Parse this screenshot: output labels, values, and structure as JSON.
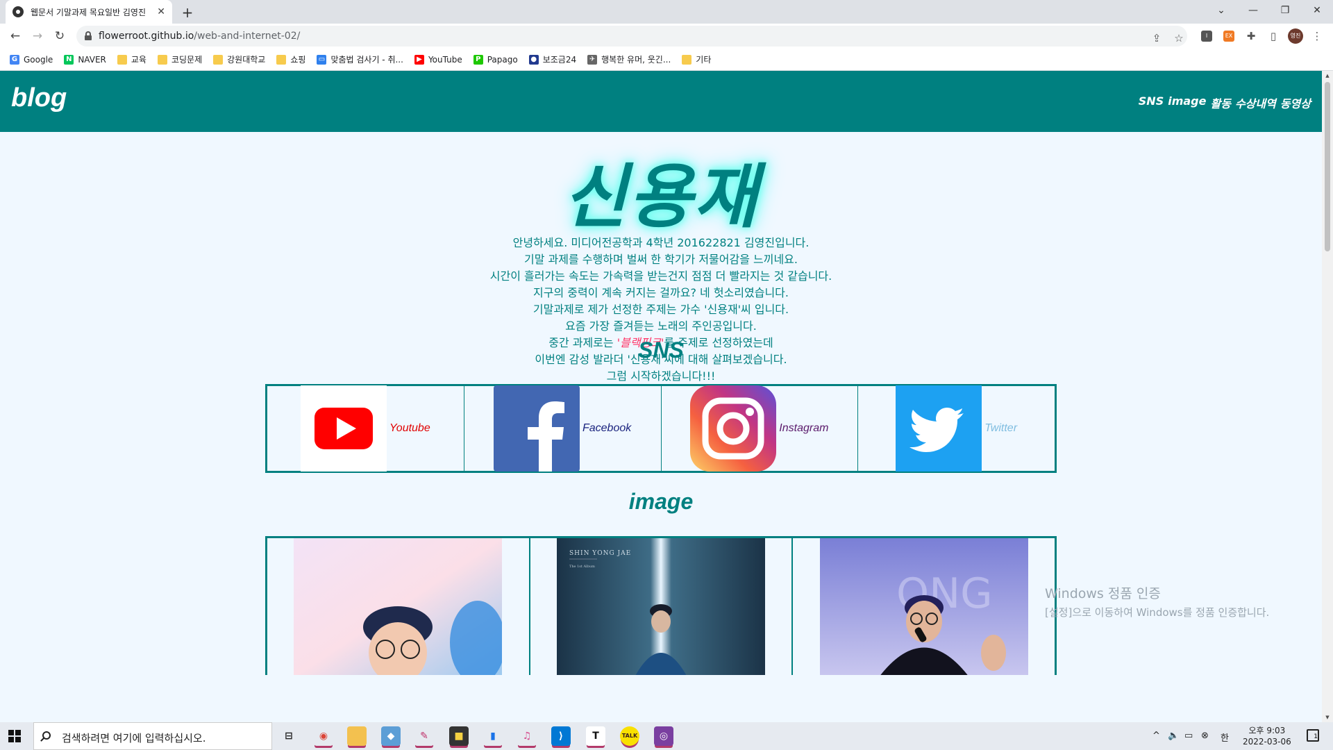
{
  "browser": {
    "tab_title": "웹문서 기말과제 목요일반 김영진",
    "tab_close": "✕",
    "new_tab": "+",
    "url_host": "flowerroot.github.io",
    "url_path": "/web-and-internet-02/",
    "window_controls": {
      "chevron": "⌄",
      "minimize": "—",
      "restore": "❐",
      "close": "✕"
    },
    "nav": {
      "back": "←",
      "forward": "→",
      "reload": "↻"
    },
    "toolbar_icons": {
      "share": "⇪",
      "star": "☆",
      "ext1": "I",
      "ext2": "EX",
      "puzzle": "✚",
      "sidepanel": "▯",
      "menu": "⋮"
    },
    "profile_initials": "영진",
    "bookmarks": [
      {
        "label": "Google",
        "icon": "google-icon",
        "glyph": "G",
        "color": "#4285f4"
      },
      {
        "label": "NAVER",
        "icon": "naver-icon",
        "glyph": "N",
        "color": "#03c75a"
      },
      {
        "label": "교육",
        "icon": "folder-icon",
        "glyph": "",
        "color": "#f7cb4d"
      },
      {
        "label": "코딩문제",
        "icon": "folder-icon",
        "glyph": "",
        "color": "#f7cb4d"
      },
      {
        "label": "강원대학교",
        "icon": "folder-icon",
        "glyph": "",
        "color": "#f7cb4d"
      },
      {
        "label": "쇼핑",
        "icon": "folder-icon",
        "glyph": "",
        "color": "#f7cb4d"
      },
      {
        "label": "맞춤법 검사기 - 취...",
        "icon": "speller-icon",
        "glyph": "▭",
        "color": "#2f80ed"
      },
      {
        "label": "YouTube",
        "icon": "youtube-icon",
        "glyph": "▶",
        "color": "#ff0000"
      },
      {
        "label": "Papago",
        "icon": "papago-icon",
        "glyph": "P",
        "color": "#1ec800"
      },
      {
        "label": "보조금24",
        "icon": "gov-icon",
        "glyph": "●",
        "color": "#223a8f"
      },
      {
        "label": "행복한 유머, 웃긴...",
        "icon": "humor-icon",
        "glyph": "✈",
        "color": "#666666"
      },
      {
        "label": "기타",
        "icon": "folder-icon",
        "glyph": "",
        "color": "#f7cb4d"
      }
    ]
  },
  "site": {
    "brand": "blog",
    "nav": [
      "SNS",
      "image",
      "활동",
      "수상내역",
      "동영상"
    ],
    "hero_name": "신용재",
    "intro": [
      "안녕하세요. 미디어전공학과 4학년 201622821 김영진입니다.",
      "기말 과제를 수행하며 벌써 한 학기가 저물어감을 느끼네요.",
      "시간이 흘러가는 속도는 가속력을 받는건지 점점 더 빨라지는 것 같습니다.",
      "지구의 중력이 계속 커지는 걸까요? 네 헛소리였습니다.",
      "기말과제로 제가 선정한 주제는 가수 '신용재'씨 입니다.",
      "요즘 가장 즐겨듣는 노래의 주인공입니다."
    ],
    "intro_mid": {
      "before": "중간 과제로는 ",
      "highlight": "'블랙핑크'",
      "after": "를 주제로 선정하였는데"
    },
    "intro_end": [
      "이번엔 감성 발라더 '신용재'씨에 대해 살펴보겠습니다.",
      "그럼 시작하겠습니다!!!"
    ],
    "sns_title": "SNS",
    "sns": [
      {
        "label": "Youtube",
        "color": "#e00000"
      },
      {
        "label": "Facebook",
        "color": "#1a237e"
      },
      {
        "label": "Instagram",
        "color": "#5a1a6b"
      },
      {
        "label": "Twitter",
        "color": "#7fbde0"
      }
    ],
    "image_title": "image",
    "album_caption_1": "SHIN YONG JAE",
    "album_caption_2": "The 1st Album"
  },
  "watermark": {
    "title": "Windows 정품 인증",
    "subtitle": "[설정]으로 이동하여 Windows를 정품 인증합니다."
  },
  "taskbar": {
    "search_placeholder": "검색하려면 여기에 입력하십시오.",
    "apps": [
      {
        "name": "task-view-icon",
        "glyph": "⊟",
        "color": "transparent",
        "fg": "#222"
      },
      {
        "name": "chrome-icon",
        "glyph": "◉",
        "color": "#e6eaf0",
        "fg": "#db4437"
      },
      {
        "name": "file-explorer-icon",
        "glyph": "▬",
        "color": "#f3c14f",
        "fg": "#f3c14f"
      },
      {
        "name": "app-tile-icon",
        "glyph": "◆",
        "color": "#5c9ed6",
        "fg": "#fff"
      },
      {
        "name": "paint-icon",
        "glyph": "✎",
        "color": "#e6eaf0",
        "fg": "#c0306a"
      },
      {
        "name": "sticky-notes-icon",
        "glyph": "■",
        "color": "#333",
        "fg": "#f5d142"
      },
      {
        "name": "phone-icon",
        "glyph": "▮",
        "color": "#e6eaf0",
        "fg": "#1a73e8"
      },
      {
        "name": "itunes-icon",
        "glyph": "♫",
        "color": "#e6eaf0",
        "fg": "#d54b8c"
      },
      {
        "name": "vscode-icon",
        "glyph": "⟩",
        "color": "#0078d4",
        "fg": "#fff"
      },
      {
        "name": "typora-icon",
        "glyph": "T",
        "color": "#fff",
        "fg": "#111"
      },
      {
        "name": "kakaotalk-icon",
        "glyph": "TALK",
        "color": "#f9e000",
        "fg": "#3a1d1d"
      },
      {
        "name": "github-desktop-icon",
        "glyph": "◎",
        "color": "#7a3fa0",
        "fg": "#fff"
      }
    ],
    "tray": {
      "caret": "^",
      "volume": "🔈",
      "network": "▭",
      "status": "⊗",
      "ime": "한"
    },
    "time": "오후 9:03",
    "date": "2022-03-06",
    "notification_count": "1"
  }
}
